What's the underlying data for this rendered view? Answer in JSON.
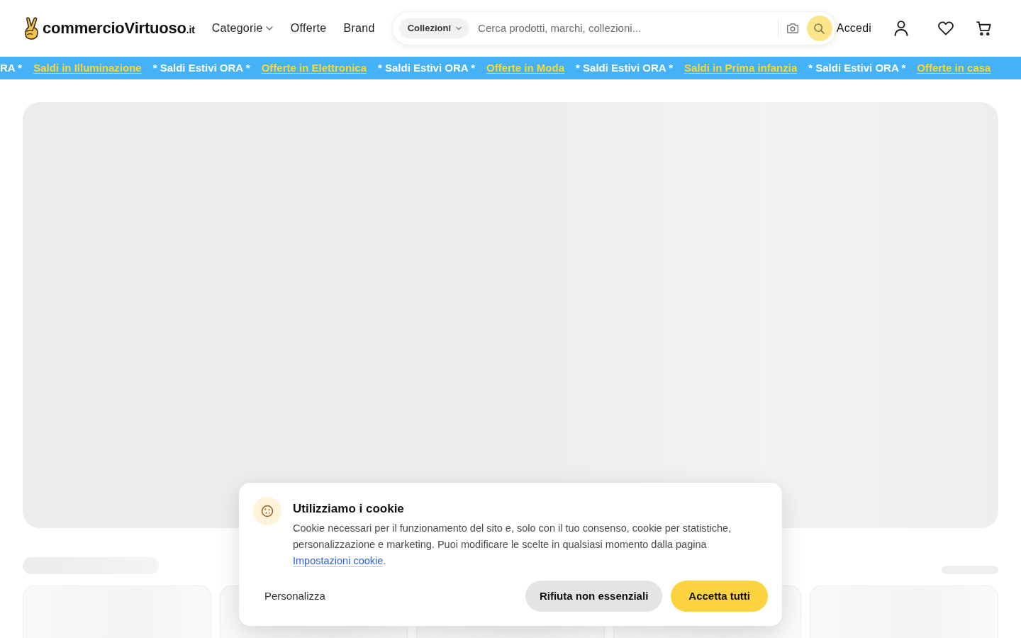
{
  "header": {
    "logo": {
      "name": "commercioVirtuoso",
      "suffix": ".it"
    },
    "nav": [
      {
        "label": "Categorie",
        "kind": "dropdown"
      },
      {
        "label": "Offerte",
        "kind": "link"
      },
      {
        "label": "Brand",
        "kind": "link"
      }
    ],
    "search": {
      "scope": "Collezioni",
      "placeholder": "Cerca prodotti, marchi, collezioni..."
    },
    "account": {
      "login": "Accedi"
    }
  },
  "ticker": [
    {
      "text": "RA *",
      "kind": "promo"
    },
    {
      "text": "Saldi in Illuminazione",
      "kind": "link"
    },
    {
      "text": "* Saldi Estivi ORA *",
      "kind": "promo"
    },
    {
      "text": "Offerte in Elettronica",
      "kind": "link"
    },
    {
      "text": "* Saldi Estivi ORA *",
      "kind": "promo"
    },
    {
      "text": "Offerte in Moda",
      "kind": "link"
    },
    {
      "text": "* Saldi Estivi ORA *",
      "kind": "promo"
    },
    {
      "text": "Saldi in Prima infanzia",
      "kind": "link"
    },
    {
      "text": "* Saldi Estivi ORA *",
      "kind": "promo"
    },
    {
      "text": "Offerte in casa",
      "kind": "link"
    }
  ],
  "cookie_banner": {
    "title": "Utilizziamo i cookie",
    "text": "Cookie necessari per il funzionamento del sito e, solo con il tuo consenso, cookie per statistiche, personalizzazione e marketing. Puoi modificare le scelte in qualsiasi momento dalla pagina",
    "link": "Impostazioni cookie",
    "after_link": ".",
    "buttons": [
      {
        "label": "Personalizza",
        "kind": "plain"
      },
      {
        "label": "Rifiuta non essenziali",
        "kind": "secondary"
      },
      {
        "label": "Accetta tutti",
        "kind": "primary"
      }
    ]
  }
}
